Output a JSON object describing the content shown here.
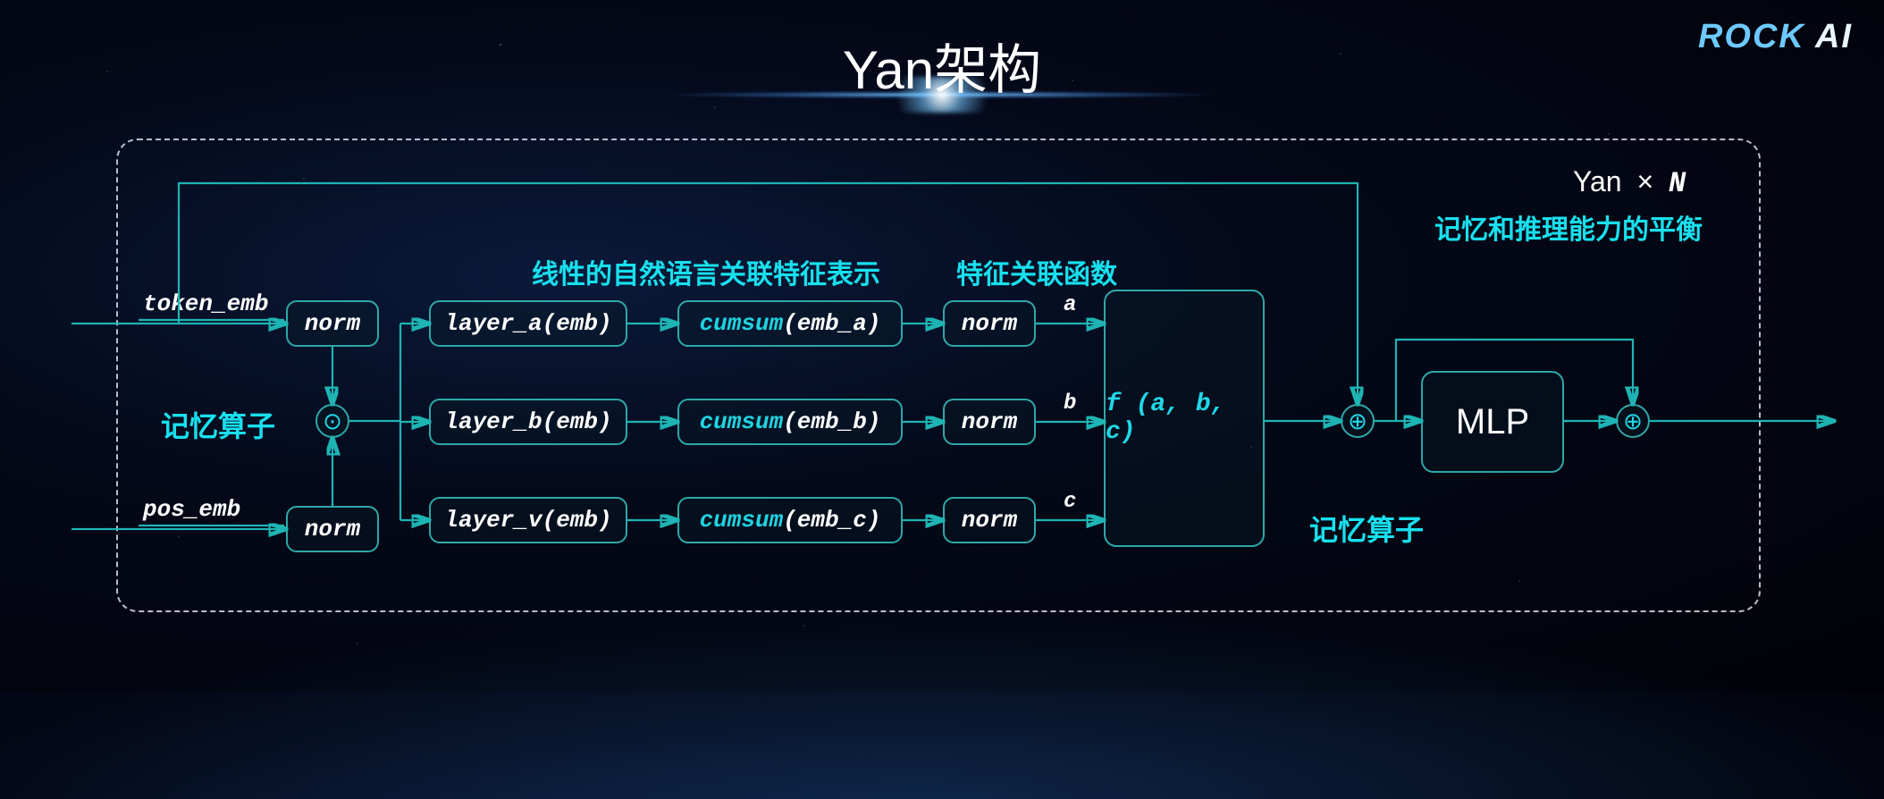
{
  "title": "Yan架构",
  "logo": {
    "rock": "ROCK",
    "ai": " AI"
  },
  "yan_label": {
    "name": "Yan",
    "times": "×",
    "n": "N"
  },
  "headers": {
    "linear_feature": "线性的自然语言关联特征表示",
    "feature_fn": "特征关联函数",
    "balance": "记忆和推理能力的平衡",
    "memory_op_left": "记忆算子",
    "memory_op_right": "记忆算子"
  },
  "inputs": {
    "token": "token_emb",
    "pos": "pos_emb"
  },
  "norm": "norm",
  "layers": {
    "a": {
      "layer": "layer_a",
      "arg": "(emb)",
      "cum_fn": "cumsum",
      "cum_arg": "(emb_a)",
      "out": "a"
    },
    "b": {
      "layer": "layer_b",
      "arg": "(emb)",
      "cum_fn": "cumsum",
      "cum_arg": "(emb_b)",
      "out": "b"
    },
    "c": {
      "layer": "layer_v",
      "arg": "(emb)",
      "cum_fn": "cumsum",
      "cum_arg": "(emb_c)",
      "out": "c"
    }
  },
  "fbox": "f (a, b, c)",
  "mlp": "MLP",
  "ops": {
    "mul": "⊙",
    "add": "⊕"
  }
}
